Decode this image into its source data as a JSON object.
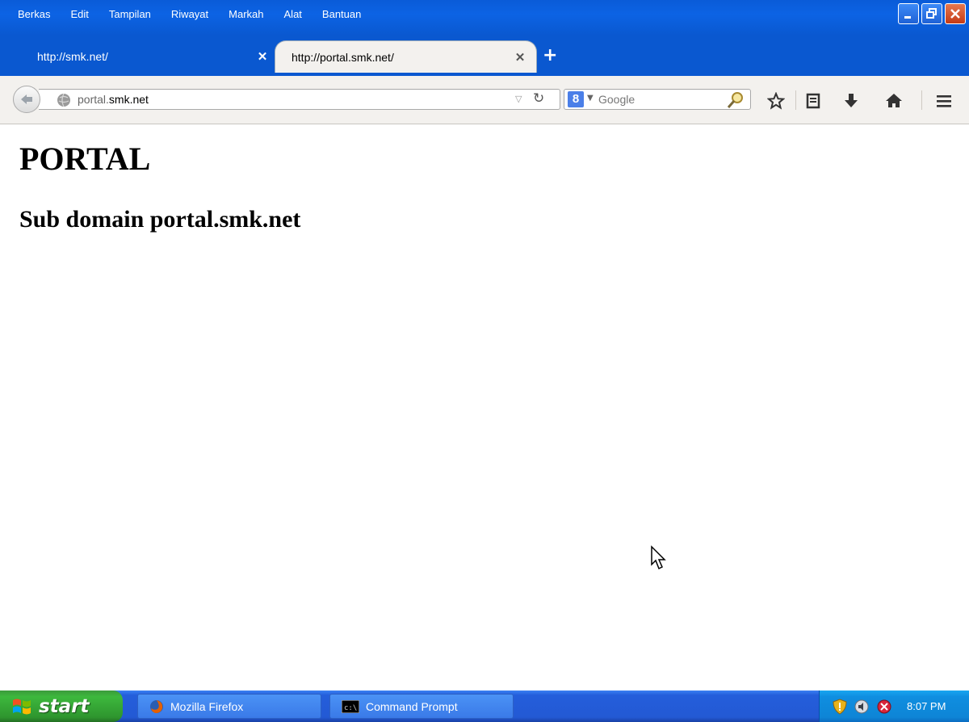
{
  "menu": {
    "items": [
      {
        "label": "Berkas"
      },
      {
        "label": "Edit"
      },
      {
        "label": "Tampilan"
      },
      {
        "label": "Riwayat"
      },
      {
        "label": "Markah"
      },
      {
        "label": "Alat"
      },
      {
        "label": "Bantuan"
      }
    ]
  },
  "tabs": [
    {
      "label": "http://smk.net/",
      "active": false
    },
    {
      "label": "http://portal.smk.net/",
      "active": true
    }
  ],
  "navbar": {
    "url_prefix": "portal.",
    "url_host": "smk.net",
    "search_placeholder": "Google"
  },
  "page": {
    "title": "PORTAL",
    "subtitle": "Sub domain portal.smk.net"
  },
  "taskbar": {
    "start_label": "start",
    "items": [
      {
        "label": "Mozilla Firefox"
      },
      {
        "label": "Command Prompt"
      }
    ],
    "clock": "8:07 PM"
  },
  "colors": {
    "titlebar": "#0a58d0",
    "toolbar": "#f3f1ee",
    "taskbar": "#245edb",
    "start": "#3db83d",
    "tray": "#0e85d6"
  },
  "icons": [
    "back-icon",
    "globe-icon",
    "dropdown-icon",
    "reload-icon",
    "google-icon",
    "search-icon",
    "bookmark-star-icon",
    "reading-list-icon",
    "download-icon",
    "home-icon",
    "menu-icon",
    "windows-logo-icon",
    "firefox-icon",
    "cmd-icon",
    "tray-shield-icon",
    "tray-sound-icon",
    "tray-security-icon",
    "mouse-cursor-icon"
  ]
}
